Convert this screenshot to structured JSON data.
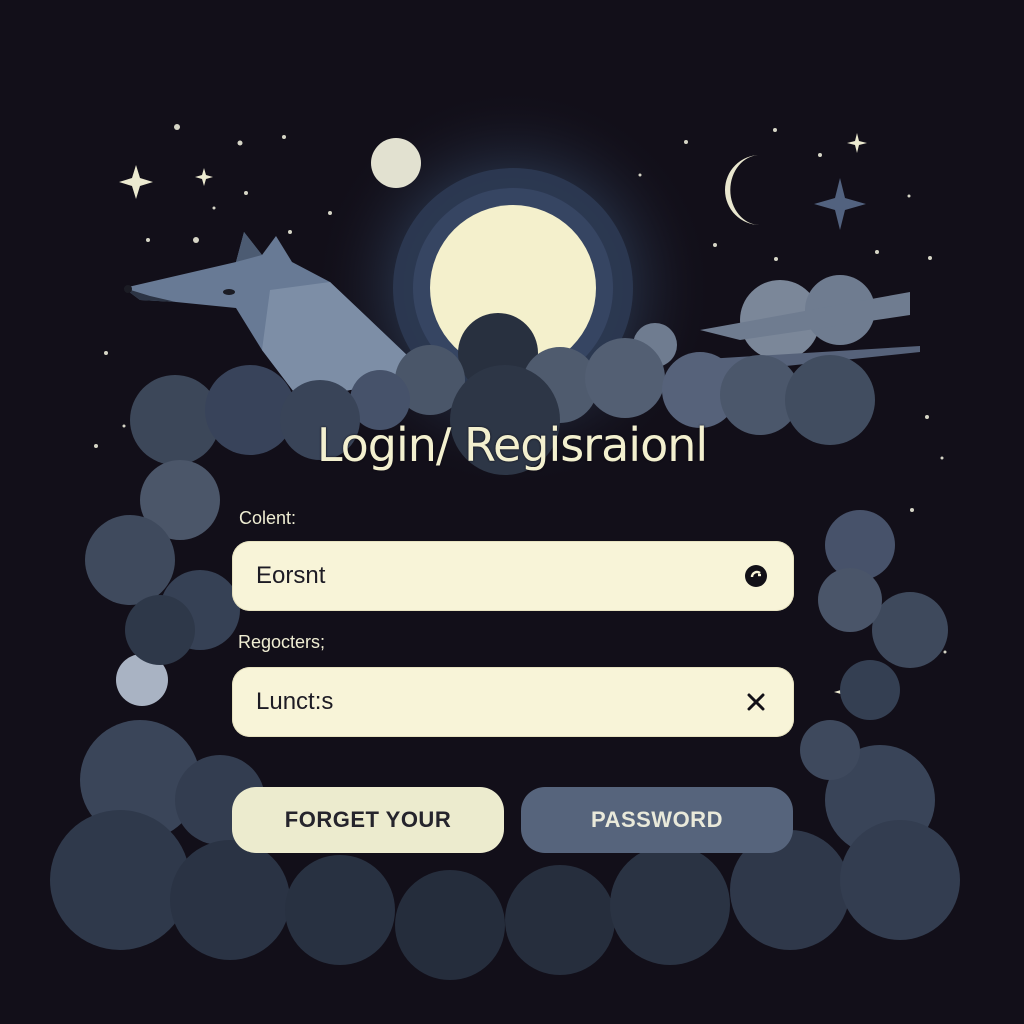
{
  "form": {
    "title": "Login/ Regisraionl",
    "client_label": "Colent:",
    "client_value": "Eorsnt",
    "register_label": "Regocters;",
    "register_value": "Lunct:s",
    "forget_button": "FORGET YOUR",
    "password_button": "PASSWORD"
  },
  "icons": {
    "client_field_icon": "circle-arrow-icon",
    "register_field_icon": "close-icon"
  },
  "colors": {
    "background": "#120f19",
    "moon": "#f4f0cc",
    "cloud": "#3e4a5c",
    "field_fill": "#f8f4d8",
    "secondary_button": "#56647c"
  }
}
